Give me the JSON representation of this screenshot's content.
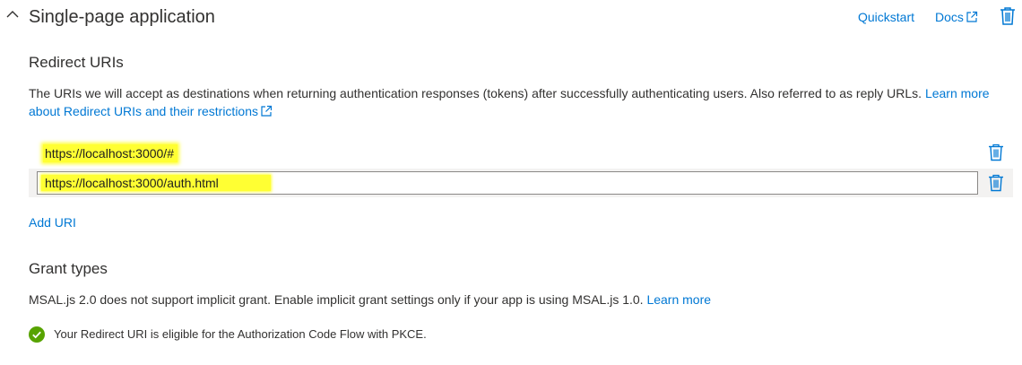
{
  "header": {
    "title": "Single-page application",
    "collapse_icon": "chevron-up-icon",
    "quickstart_label": "Quickstart",
    "docs_label": "Docs",
    "docs_icon": "external-link-icon",
    "delete_icon": "trash-icon"
  },
  "redirect": {
    "heading": "Redirect URIs",
    "description": "The URIs we will accept as destinations when returning authentication responses (tokens) after successfully authenticating users. Also referred to as reply URLs.",
    "learn_more_label": "Learn more about Redirect URIs and their restrictions",
    "uris": [
      {
        "value": "https://localhost:3000/#",
        "delete_icon": "trash-icon"
      },
      {
        "value": "https://localhost:3000/auth.html",
        "delete_icon": "trash-icon"
      }
    ],
    "add_uri_label": "Add URI"
  },
  "grant": {
    "heading": "Grant types",
    "description": "MSAL.js 2.0 does not support implicit grant. Enable implicit grant settings only if your app is using MSAL.js 1.0.",
    "learn_more_label": "Learn more"
  },
  "status": {
    "icon": "check-circle-icon",
    "text": "Your Redirect URI is eligible for the Authorization Code Flow with PKCE."
  },
  "colors": {
    "link": "#0078d4",
    "highlight": "#ffff33",
    "success": "#57a300",
    "text": "#323130"
  }
}
